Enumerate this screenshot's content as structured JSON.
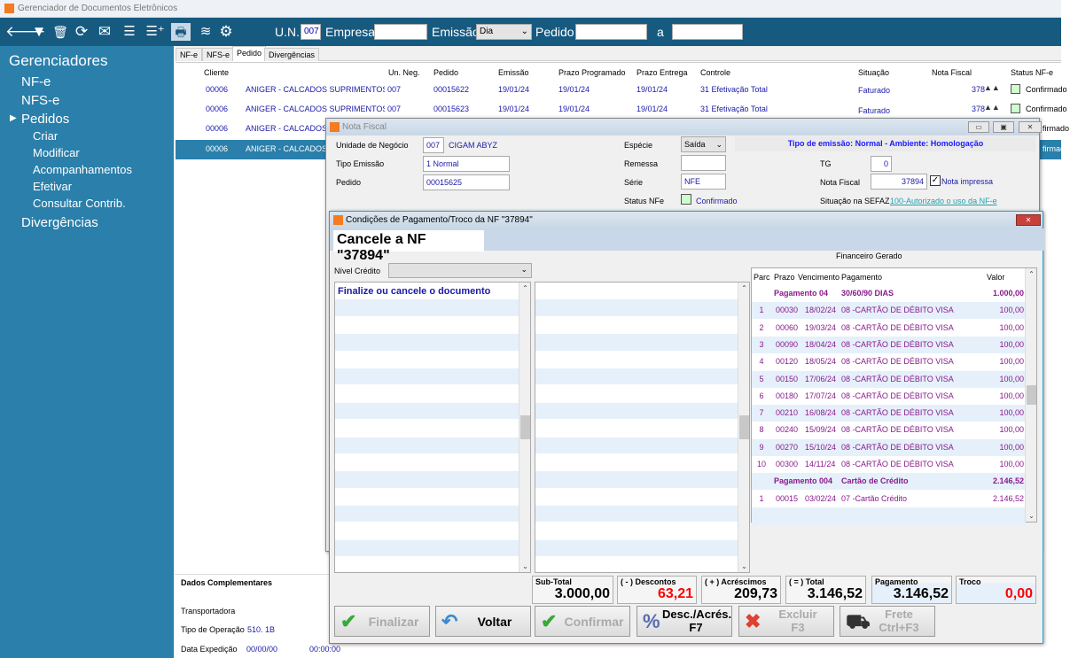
{
  "app": {
    "title": "Gerenciador de Documentos Eletrônicos",
    "logo": "S"
  },
  "toolbar": {
    "icons": [
      "back-arrow-icon",
      "filter-icon",
      "trash-icon",
      "refresh-icon",
      "mail-icon",
      "checklist-icon",
      "add-row-icon",
      "print-icon",
      "database-icon",
      "gear-icon"
    ],
    "un_label": "U.N.",
    "un_value": "007",
    "empresa_label": "Empresa",
    "empresa_value": "",
    "emissao_label": "Emissão",
    "emissao_value": "Dia",
    "pedido_label": "Pedido",
    "pedido_from": "",
    "a_label": "a",
    "pedido_to": ""
  },
  "sidebar": {
    "title": "Gerenciadores",
    "items": [
      {
        "label": "NF-e"
      },
      {
        "label": "NFS-e"
      },
      {
        "label": "Pedidos",
        "expanded": true
      },
      {
        "label": "Criar"
      },
      {
        "label": "Modificar"
      },
      {
        "label": "Acompanhamentos"
      },
      {
        "label": "Efetivar"
      },
      {
        "label": "Consultar Contrib."
      },
      {
        "label": "Divergências"
      }
    ]
  },
  "tabs": [
    {
      "label": "NF-e"
    },
    {
      "label": "NFS-e"
    },
    {
      "label": "Pedido",
      "active": true
    },
    {
      "label": "Divergências"
    }
  ],
  "grid": {
    "headers": [
      "Cliente",
      "Un. Neg.",
      "Pedido",
      "Emissão",
      "Prazo Programado",
      "Prazo Entrega",
      "Controle",
      "Situação",
      "Nota Fiscal",
      "Status NF-e"
    ],
    "rows": [
      {
        "cliente": "00006",
        "nome": "ANIGER - CALCADOS SUPRIMENTOS E E",
        "un": "007",
        "pedido": "00015622",
        "emissao": "19/01/24",
        "prazo_prog": "19/01/24",
        "prazo_ent": "19/01/24",
        "controle": "31  Efetivação Total",
        "situacao": "Faturado",
        "nf": "378",
        "status": "Confirmado"
      },
      {
        "cliente": "00006",
        "nome": "ANIGER - CALCADOS SUPRIMENTOS E E",
        "un": "007",
        "pedido": "00015623",
        "emissao": "19/01/24",
        "prazo_prog": "19/01/24",
        "prazo_ent": "19/01/24",
        "controle": "31  Efetivação Total",
        "situacao": "Faturado",
        "nf": "378",
        "status": "Confirmado"
      },
      {
        "cliente": "00006",
        "nome": "ANIGER - CALCADOS S",
        "status": "firmado"
      },
      {
        "cliente": "00006",
        "nome": "ANIGER - CALCADOS S",
        "status": "firmado"
      }
    ]
  },
  "nota_fiscal": {
    "title": "Nota Fiscal",
    "unidade_label": "Unidade de Negócio",
    "unidade_value": "007",
    "unidade_name": "CIGAM ABYZ",
    "tipo_label": "Tipo Emissão",
    "tipo_value": "1 Normal",
    "pedido_label": "Pedido",
    "pedido_value": "00015625",
    "especie_label": "Espécie",
    "especie_value": "Saída",
    "remessa_label": "Remessa",
    "remessa_value": "",
    "serie_label": "Série",
    "serie_value": "NFE",
    "status_label": "Status NFe",
    "status_value": "Confirmado",
    "banner": "Tipo de emissão: Normal - Ambiente: Homologação",
    "tg_label": "TG",
    "tg_value": "0",
    "nf_label": "Nota Fiscal",
    "nf_value": "37894",
    "impressa_label": "Nota impressa",
    "impressa_checked": true,
    "sefaz_label": "Situação na SEFAZ",
    "sefaz_value": "100-Autorizado o uso da NF-e"
  },
  "dados": {
    "title": "Dados Complementares",
    "transportadora_label": "Transportadora",
    "tipo_op_label": "Tipo de Operação",
    "tipo_op_value": "510. 1B",
    "data_exp_label": "Data Expedição",
    "data_exp_date": "00/00/00",
    "data_exp_time": "00:00:00"
  },
  "pagamento": {
    "title": "Condições de Pagamento/Troco da NF \"37894\"",
    "tab": "Cancele a NF \"37894\"",
    "nivel_label": "Nível Crédito",
    "nivel_value": "",
    "message": "Finalize ou cancele o documento",
    "fin_title": "Financeiro Gerado",
    "fin_headers": [
      "Parc",
      "Prazo",
      "Vencimento",
      "Pagamento",
      "Valor"
    ],
    "fin_rows": [
      {
        "group": true,
        "label": "Pagamento   04",
        "desc": "30/60/90 DIAS",
        "valor": "1.000,00"
      },
      {
        "parc": "1",
        "prazo": "00030",
        "venc": "18/02/24",
        "pag": "08 -CARTÃO DE DÉBITO VISA",
        "valor": "100,00"
      },
      {
        "parc": "2",
        "prazo": "00060",
        "venc": "19/03/24",
        "pag": "08 -CARTÃO DE DÉBITO VISA",
        "valor": "100,00"
      },
      {
        "parc": "3",
        "prazo": "00090",
        "venc": "18/04/24",
        "pag": "08 -CARTÃO DE DÉBITO VISA",
        "valor": "100,00"
      },
      {
        "parc": "4",
        "prazo": "00120",
        "venc": "18/05/24",
        "pag": "08 -CARTÃO DE DÉBITO VISA",
        "valor": "100,00"
      },
      {
        "parc": "5",
        "prazo": "00150",
        "venc": "17/06/24",
        "pag": "08 -CARTÃO DE DÉBITO VISA",
        "valor": "100,00"
      },
      {
        "parc": "6",
        "prazo": "00180",
        "venc": "17/07/24",
        "pag": "08 -CARTÃO DE DÉBITO VISA",
        "valor": "100,00"
      },
      {
        "parc": "7",
        "prazo": "00210",
        "venc": "16/08/24",
        "pag": "08 -CARTÃO DE DÉBITO VISA",
        "valor": "100,00"
      },
      {
        "parc": "8",
        "prazo": "00240",
        "venc": "15/09/24",
        "pag": "08 -CARTÃO DE DÉBITO VISA",
        "valor": "100,00"
      },
      {
        "parc": "9",
        "prazo": "00270",
        "venc": "15/10/24",
        "pag": "08 -CARTÃO DE DÉBITO VISA",
        "valor": "100,00"
      },
      {
        "parc": "10",
        "prazo": "00300",
        "venc": "14/11/24",
        "pag": "08 -CARTÃO DE DÉBITO VISA",
        "valor": "100,00"
      },
      {
        "group": true,
        "label": "Pagamento  004",
        "desc": "Cartão de Crédito",
        "valor": "2.146,52"
      },
      {
        "parc": "1",
        "prazo": "00015",
        "venc": "03/02/24",
        "pag": "07 -Cartão Crédito",
        "valor": "2.146,52"
      }
    ],
    "totals": [
      {
        "label": "Sub-Total",
        "value": "3.000,00",
        "color": "#000000"
      },
      {
        "label": "( - ) Descontos",
        "value": "63,21",
        "color": "#ff0000"
      },
      {
        "label": "( + ) Acréscimos",
        "value": "209,73",
        "color": "#000000"
      },
      {
        "label": "( = ) Total",
        "value": "3.146,52",
        "color": "#000000"
      },
      {
        "label": "Pagamento",
        "value": "3.146,52",
        "color": "#000000"
      },
      {
        "label": "Troco",
        "value": "0,00",
        "color": "#ff0000"
      }
    ],
    "buttons": [
      {
        "label": "Finalizar",
        "enabled": false
      },
      {
        "label": "Voltar",
        "enabled": true
      },
      {
        "label": "Confirmar",
        "enabled": false
      },
      {
        "label": "Desc./Acrés.",
        "key": "F7",
        "enabled": true
      },
      {
        "label": "Excluir",
        "key": "F3",
        "enabled": false
      },
      {
        "label": "Frete",
        "key": "Ctrl+F3",
        "enabled": false
      }
    ]
  }
}
